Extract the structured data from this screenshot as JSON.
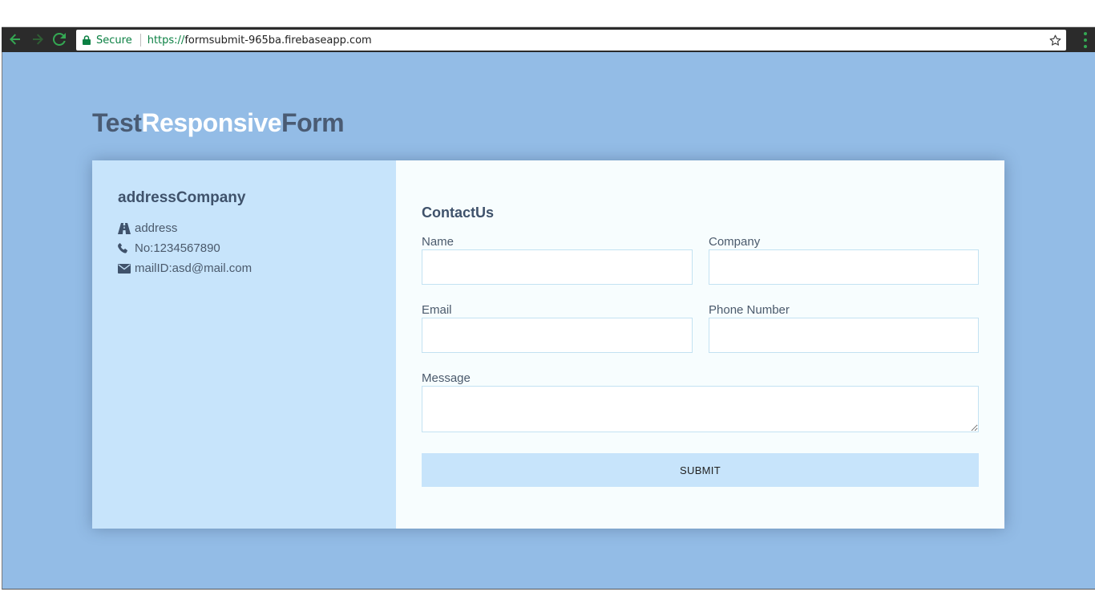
{
  "browser": {
    "secure_label": "Secure",
    "url_scheme": "https://",
    "url_host": "formsubmit-965ba.firebaseapp.com",
    "accent_color": "#34a853",
    "icons": [
      "back-arrow-icon",
      "forward-arrow-icon",
      "reload-icon",
      "lock-icon",
      "star-icon",
      "menu-dots-icon"
    ]
  },
  "page": {
    "brand": {
      "part1": "Test",
      "part2": "Responsive",
      "part3": "Form"
    },
    "background_color": "#93bce6"
  },
  "company": {
    "title": "addressCompany",
    "items": [
      {
        "icon": "road-icon",
        "text": "address"
      },
      {
        "icon": "phone-icon",
        "text": "No:1234567890"
      },
      {
        "icon": "envelope-icon",
        "text": "mailID:asd@mail.com"
      }
    ]
  },
  "form": {
    "title": "ContactUs",
    "fields": {
      "name": {
        "label": "Name",
        "value": ""
      },
      "company": {
        "label": "Company",
        "value": ""
      },
      "email": {
        "label": "Email",
        "value": ""
      },
      "phone": {
        "label": "Phone Number",
        "value": ""
      },
      "message": {
        "label": "Message",
        "value": ""
      }
    },
    "submit_label": "SUBMIT"
  }
}
